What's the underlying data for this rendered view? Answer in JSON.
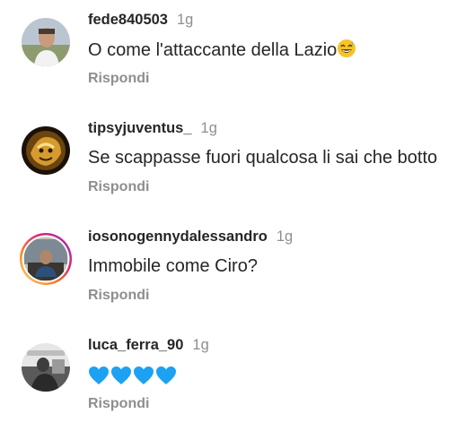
{
  "comments": [
    {
      "username": "fede840503",
      "time": "1g",
      "text": "O come l'attaccante della Lazio",
      "emoji": "grinning-sweat-emoji",
      "reply_label": "Rispondi"
    },
    {
      "username": "tipsyjuventus_",
      "time": "1g",
      "text": "Se scappasse fuori qualcosa li sai che botto",
      "reply_label": "Rispondi"
    },
    {
      "username": "iosonogennydalessandro",
      "time": "1g",
      "text": "Immobile come Ciro?",
      "reply_label": "Rispondi",
      "avatar_story_ring": true
    },
    {
      "username": "luca_ferra_90",
      "time": "1g",
      "text": "",
      "emoji": "blue-heart-emoji x4",
      "reply_label": "Rispondi"
    }
  ],
  "colors": {
    "text": "#262626",
    "secondary": "#8e8e8e",
    "heart": "#1da1f2"
  }
}
